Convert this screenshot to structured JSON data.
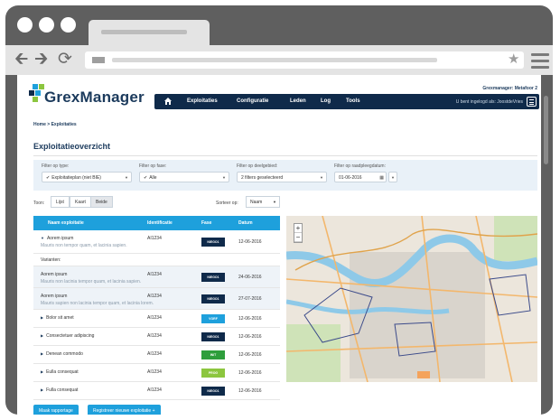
{
  "app": {
    "name": "GrexManager",
    "instance_label": "Grexmanager: Metafoor 2",
    "logged_in_as": "U bent ingelogd als: JoostdeVries"
  },
  "nav": {
    "items": [
      "Exploitaties",
      "Configuratie",
      "Leden",
      "Log",
      "Tools"
    ]
  },
  "breadcrumb": "Home > Exploitaties",
  "page_title": "Exploitatieoverzicht",
  "filters": {
    "type": {
      "label": "Filter op type:",
      "value": "Exploitatieplan (niet BIE)"
    },
    "phase": {
      "label": "Filter op fase:",
      "value": "Alle"
    },
    "area": {
      "label": "Filter op deelgebied:",
      "value": "2 filters geselecteerd"
    },
    "date": {
      "label": "Filter op raadpleegdatum:",
      "value": "01-06-2016"
    }
  },
  "view": {
    "label": "Toon:",
    "options": [
      "Lijst",
      "Kaart",
      "Beide"
    ],
    "active": "Beide"
  },
  "sort": {
    "label": "Sorteer op:",
    "value": "Naam"
  },
  "table": {
    "headers": [
      "Naam exploitatie",
      "Identificatie",
      "Fase",
      "Datum"
    ],
    "rows": [
      {
        "name": "Aorem ipsum",
        "desc": "Mauris non tempor quam, et lacinia sapien.",
        "id": "AI1234",
        "phase": "NIEGO1",
        "phase_color": "#0f2a4a",
        "date": "12-06-2016",
        "expanded": true
      },
      {
        "name": "Varianten:",
        "variant_header": true
      },
      {
        "name": "Aorem ipsum",
        "desc": "Mauris non lacinia tempor quam, et lacinia sapien.",
        "id": "AI1234",
        "phase": "NIEGO1",
        "phase_color": "#0f2a4a",
        "date": "24-06-2016",
        "sub": true
      },
      {
        "name": "Aorem ipsum",
        "desc": "Mauris sapien non lacinia tempor quam, et lacinia lorem.",
        "id": "AI1234",
        "phase": "NIEGO1",
        "phase_color": "#0f2a4a",
        "date": "27-07-2016",
        "sub": true
      },
      {
        "name": "Bolor sit amet",
        "id": "AI1234",
        "phase": "VORF",
        "phase_color": "#1ea0dc",
        "date": "12-06-2016"
      },
      {
        "name": "Consectetuer adipiscing",
        "id": "AI1234",
        "phase": "NIEGO1",
        "phase_color": "#0f2a4a",
        "date": "12-06-2016"
      },
      {
        "name": "Denean commodo",
        "id": "AI1234",
        "phase": "INIT",
        "phase_color": "#2e9e3c",
        "date": "12-06-2016"
      },
      {
        "name": "Eulla consequat",
        "id": "AI1234",
        "phase": "PROG",
        "phase_color": "#8cc63f",
        "date": "12-06-2016"
      },
      {
        "name": "Fulla consequat",
        "id": "AI1234",
        "phase": "NIEGO1",
        "phase_color": "#0f2a4a",
        "date": "12-06-2016"
      }
    ]
  },
  "buttons": {
    "report": "Maak rapportage",
    "register": "Registreer nieuwe exploitatie"
  }
}
